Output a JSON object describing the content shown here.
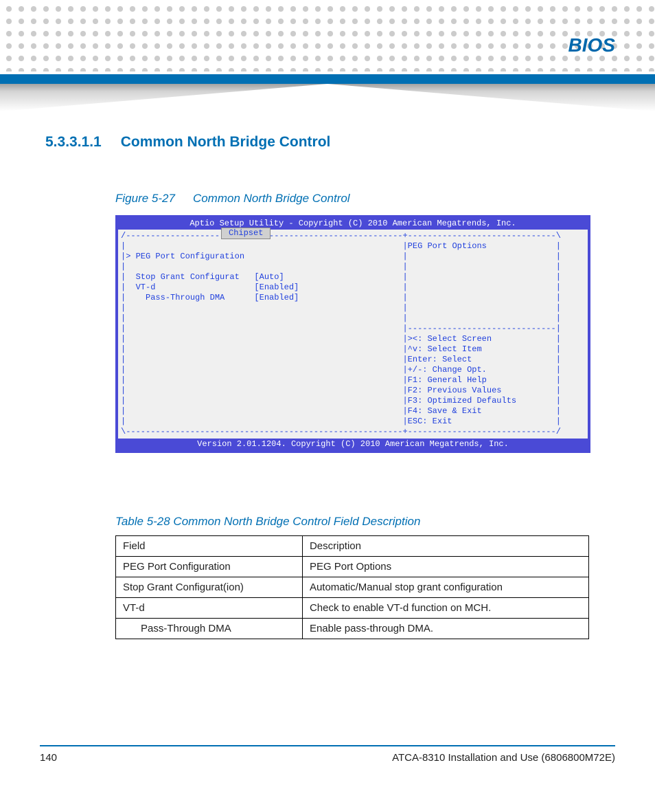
{
  "chapter": "BIOS",
  "section": {
    "number": "5.3.3.1.1",
    "title": "Common North Bridge Control"
  },
  "figure": {
    "label": "Figure 5-27",
    "title": "Common North Bridge Control"
  },
  "bios": {
    "header": "Aptio Setup Utility - Copyright (C) 2010 American Megatrends, Inc.",
    "tab": "Chipset",
    "help_title": "PEG Port Options",
    "items": [
      {
        "label": "PEG Port Configuration",
        "value": "",
        "selected": true
      },
      {
        "label": "Stop Grant Configurat",
        "value": "[Auto]"
      },
      {
        "label": "VT-d",
        "value": "[Enabled]"
      },
      {
        "label": "  Pass-Through DMA",
        "value": "[Enabled]",
        "cursor_after": true
      }
    ],
    "keys": [
      "><: Select Screen",
      "^v: Select Item",
      "Enter: Select",
      "+/-: Change Opt.",
      "F1: General Help",
      "F2: Previous Values",
      "F3: Optimized Defaults",
      "F4: Save & Exit",
      "ESC: Exit"
    ],
    "footer": "Version 2.01.1204. Copyright (C) 2010 American Megatrends, Inc."
  },
  "table_caption": "Table 5-28 Common North Bridge Control Field Description",
  "table": {
    "headers": [
      "Field",
      "Description"
    ],
    "rows": [
      [
        "PEG Port Configuration",
        "PEG Port Options"
      ],
      [
        "Stop Grant Configurat(ion)",
        "Automatic/Manual stop grant configuration"
      ],
      [
        "VT-d",
        "Check to enable VT-d function on MCH."
      ],
      [
        "Pass-Through DMA",
        "Enable pass-through DMA."
      ]
    ],
    "indent_rows": [
      3
    ]
  },
  "footer": {
    "page": "140",
    "doc": "ATCA-8310 Installation and Use (6806800M72E)"
  }
}
